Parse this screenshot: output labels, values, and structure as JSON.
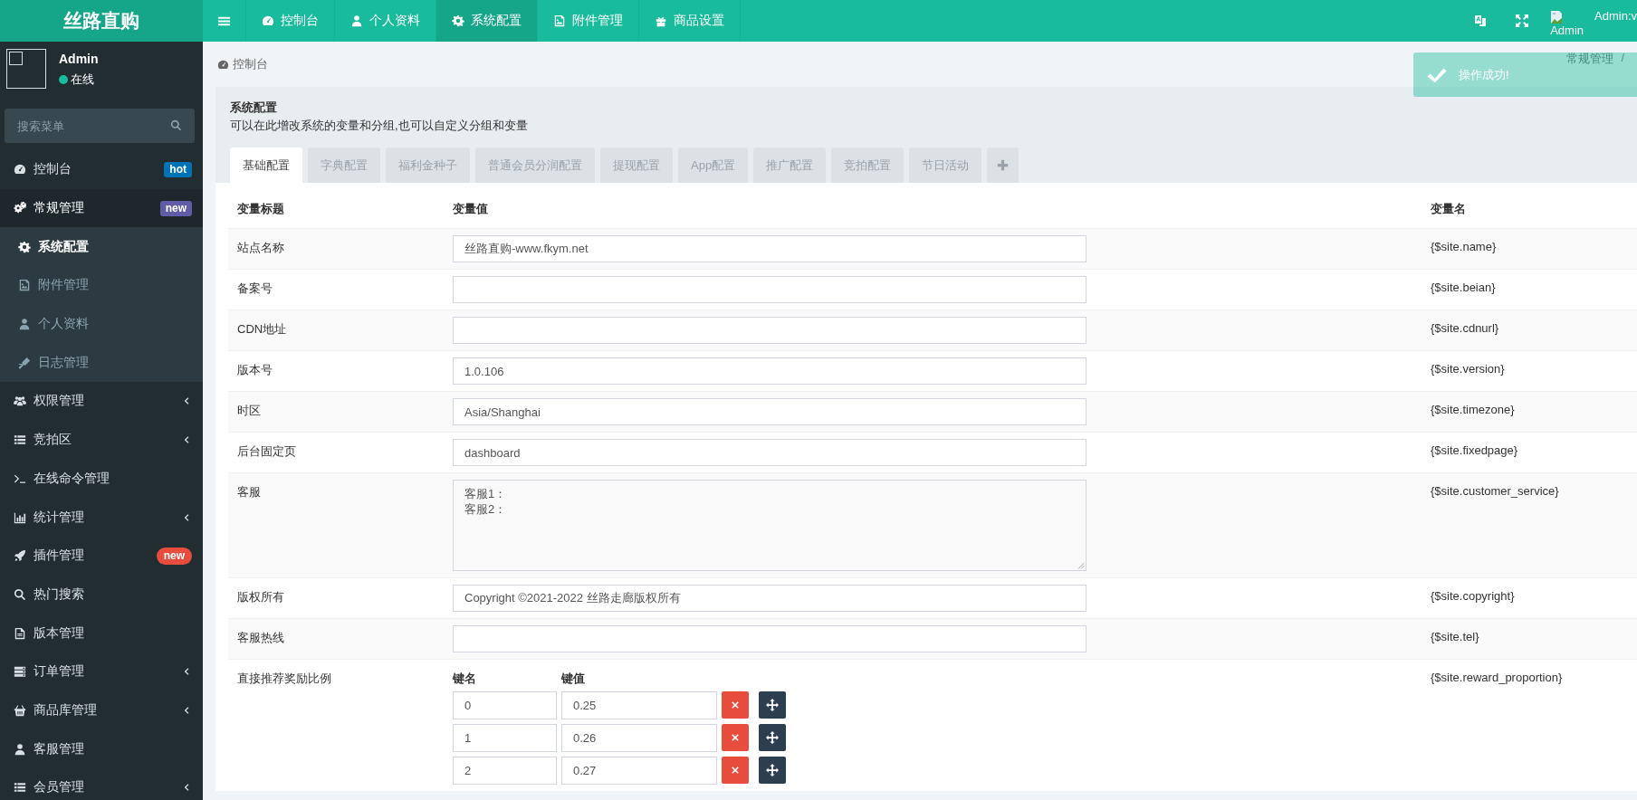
{
  "header": {
    "logo": "丝路直购",
    "nav": [
      {
        "label": "控制台",
        "selected": false
      },
      {
        "label": "个人资料",
        "selected": false
      },
      {
        "label": "系统配置",
        "selected": true
      },
      {
        "label": "附件管理",
        "selected": false
      },
      {
        "label": "商品设置",
        "selected": false
      }
    ],
    "user": {
      "name": "Admin:v",
      "avatar_alt": "Admin"
    }
  },
  "sidebar": {
    "user": {
      "name": "Admin",
      "status": "在线"
    },
    "search": {
      "placeholder": "搜索菜单"
    },
    "menu": [
      {
        "label": "控制台",
        "selected": false,
        "badge": {
          "text": "hot",
          "kind": "tag",
          "color": "#0073b7"
        }
      },
      {
        "label": "常规管理",
        "selected": false,
        "expanded": true,
        "badge": {
          "text": "new",
          "kind": "tag",
          "color": "#605ca8"
        },
        "children": [
          {
            "label": "系统配置",
            "selected": true
          },
          {
            "label": "附件管理",
            "selected": false
          },
          {
            "label": "个人资料",
            "selected": false
          },
          {
            "label": "日志管理",
            "selected": false
          }
        ]
      },
      {
        "label": "权限管理",
        "selected": false,
        "expanded": false
      },
      {
        "label": "竞拍区",
        "selected": false,
        "expanded": false
      },
      {
        "label": "在线命令管理",
        "selected": false
      },
      {
        "label": "统计管理",
        "selected": false,
        "expanded": false
      },
      {
        "label": "插件管理",
        "selected": false,
        "badge": {
          "text": "new",
          "kind": "pill",
          "color": "#e74c3c"
        }
      },
      {
        "label": "热门搜索",
        "selected": false
      },
      {
        "label": "版本管理",
        "selected": false
      },
      {
        "label": "订单管理",
        "selected": false,
        "expanded": false
      },
      {
        "label": "商品库管理",
        "selected": false,
        "expanded": false
      },
      {
        "label": "客服管理",
        "selected": false
      },
      {
        "label": "会员管理",
        "selected": false,
        "expanded": false
      }
    ]
  },
  "breadcrumb": {
    "left": "控制台",
    "right": "常规管理",
    "separator": "/"
  },
  "toast": {
    "text": "操作成功!"
  },
  "panel": {
    "title": "系统配置",
    "description": "可以在此增改系统的变量和分组,也可以自定义分组和变量",
    "tabs": [
      {
        "label": "基础配置",
        "selected": true
      },
      {
        "label": "字典配置",
        "selected": false
      },
      {
        "label": "福利金种子",
        "selected": false
      },
      {
        "label": "普通会员分润配置",
        "selected": false
      },
      {
        "label": "提现配置",
        "selected": false
      },
      {
        "label": "App配置",
        "selected": false
      },
      {
        "label": "推广配置",
        "selected": false
      },
      {
        "label": "竞拍配置",
        "selected": false
      },
      {
        "label": "节日活动",
        "selected": false
      }
    ],
    "table": {
      "columns": [
        "变量标题",
        "变量值",
        "变量名"
      ],
      "rows": [
        {
          "title": "站点名称",
          "kind": "input",
          "value": "丝路直购-www.fkym.net",
          "variable": "{$site.name}"
        },
        {
          "title": "备案号",
          "kind": "input",
          "variable": "{$site.beian}"
        },
        {
          "title": "CDN地址",
          "kind": "input",
          "variable": "{$site.cdnurl}"
        },
        {
          "title": "版本号",
          "kind": "input",
          "value": "1.0.106",
          "variable": "{$site.version}"
        },
        {
          "title": "时区",
          "kind": "input",
          "value": "Asia/Shanghai",
          "variable": "{$site.timezone}"
        },
        {
          "title": "后台固定页",
          "kind": "input",
          "value": "dashboard",
          "variable": "{$site.fixedpage}"
        },
        {
          "title": "客服",
          "kind": "textarea",
          "lines": [
            "客服1：",
            "客服2："
          ],
          "variable": "{$site.customer_service}"
        },
        {
          "title": "版权所有",
          "kind": "input",
          "value": "Copyright ©2021-2022 丝路走廊版权所有",
          "variable": "{$site.copyright}"
        },
        {
          "title": "客服热线",
          "kind": "input",
          "variable": "{$site.tel}"
        },
        {
          "title": "直接推荐奖励比例",
          "kind": "array",
          "key_header": "键名",
          "value_header": "键值",
          "pairs": [
            {
              "key": "0",
              "value": "0.25"
            },
            {
              "key": "1",
              "value": "0.26"
            },
            {
              "key": "2",
              "value": "0.27"
            }
          ],
          "variable": "{$site.reward_proportion}"
        }
      ]
    }
  }
}
